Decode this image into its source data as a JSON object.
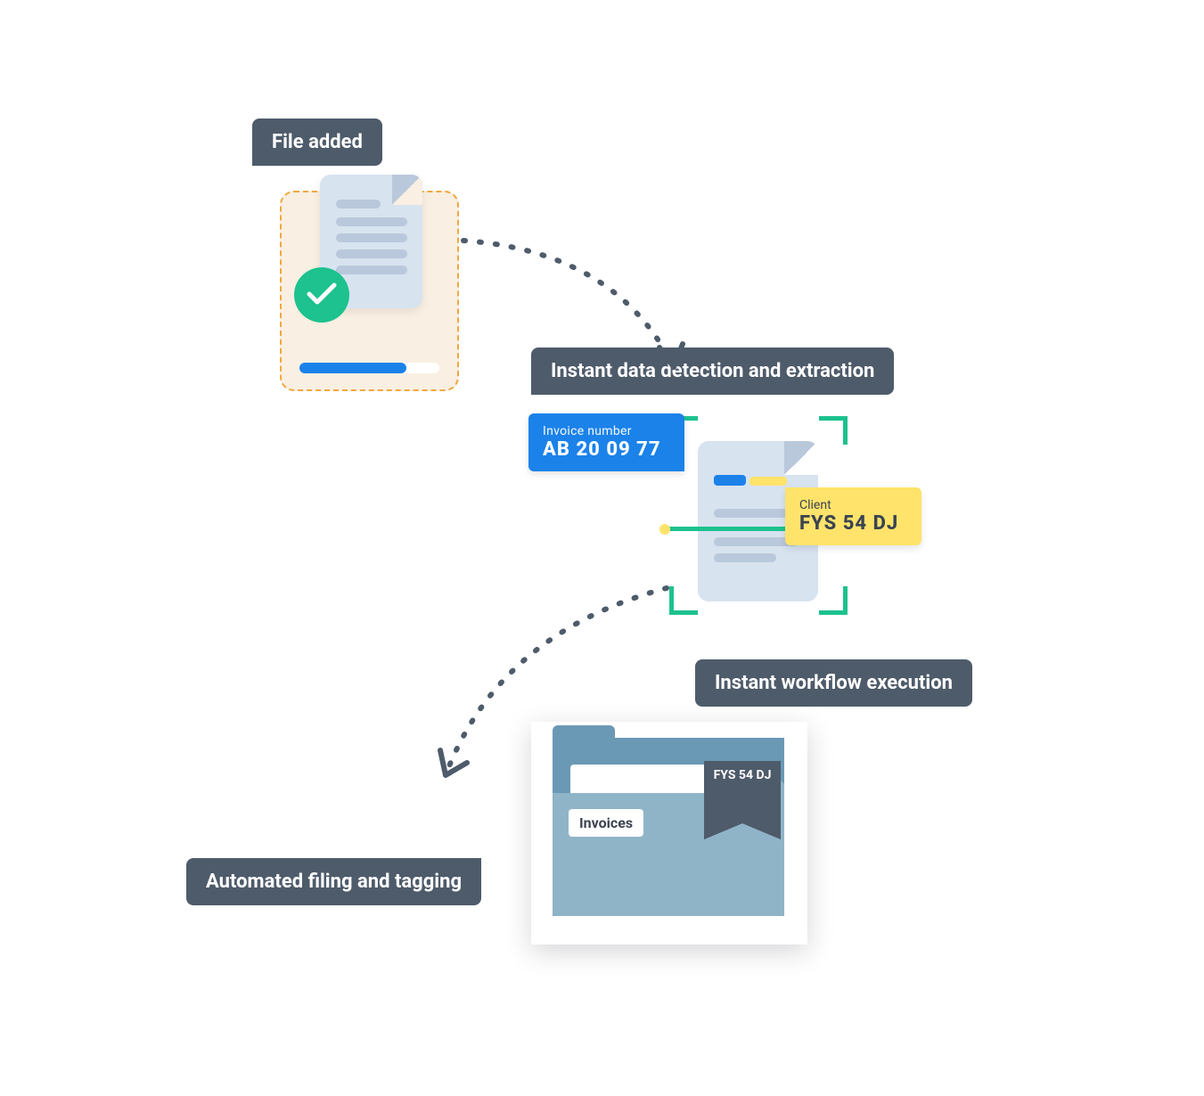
{
  "steps": {
    "file_added": "File added",
    "extraction": "Instant data detection and extraction",
    "workflow": "Instant workflow execution",
    "filing": "Automated filing and tagging"
  },
  "invoice_chip": {
    "caption": "Invoice number",
    "value": "AB 20 09 77"
  },
  "client_chip": {
    "caption": "Client",
    "value": "FYS 54 DJ"
  },
  "folder": {
    "label": "Invoices",
    "ribbon_tag": "FYS 54 DJ"
  },
  "colors": {
    "slate": "#4e5b6a",
    "blue": "#1b82ea",
    "green": "#1dc28e",
    "yellow": "#ffe36b",
    "folder_back": "#6a99b5",
    "folder_front": "#8fb4c8",
    "dropzone_border": "#f0a83e",
    "dropzone_bg": "#f9efe2"
  }
}
